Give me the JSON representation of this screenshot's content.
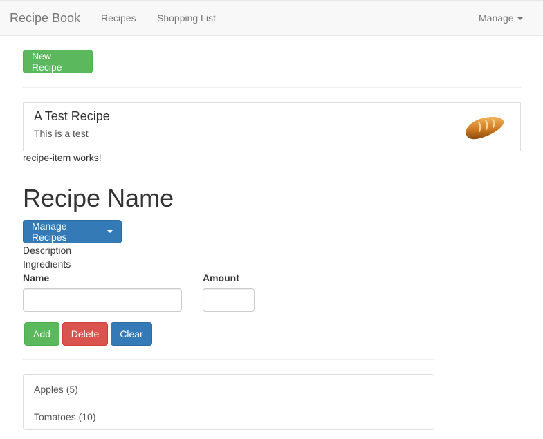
{
  "navbar": {
    "brand": "Recipe Book",
    "links": [
      "Recipes",
      "Shopping List"
    ],
    "manage_label": "Manage"
  },
  "actions": {
    "new_recipe_label": "New Recipe"
  },
  "recipe_list": {
    "items": [
      {
        "name": "A Test Recipe",
        "description": "This is a test",
        "image_icon": "bread-icon"
      }
    ],
    "footer_text": "recipe-item works!"
  },
  "detail": {
    "title": "Recipe Name",
    "manage_button_label": "Manage Recipes",
    "description_label": "Description",
    "ingredients_label": "Ingredients"
  },
  "shopping_edit": {
    "name_label": "Name",
    "amount_label": "Amount",
    "name_value": "",
    "amount_value": "",
    "add_label": "Add",
    "delete_label": "Delete",
    "clear_label": "Clear"
  },
  "ingredients": [
    "Apples (5)",
    "Tomatoes (10)"
  ],
  "colors": {
    "success": "#5cb85c",
    "danger": "#d9534f",
    "primary": "#337ab7",
    "navbar_bg": "#f8f8f8"
  }
}
